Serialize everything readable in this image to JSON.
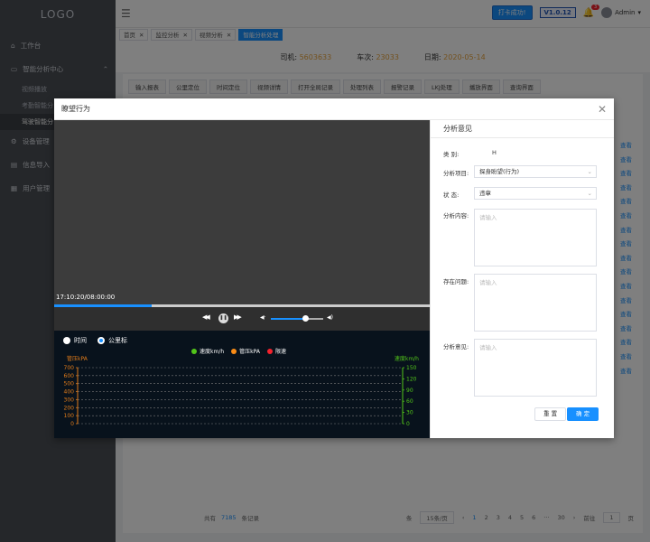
{
  "sidebar": {
    "logo": "LOGO",
    "items": [
      {
        "label": "工作台",
        "icon": "home-icon"
      },
      {
        "label": "智能分析中心",
        "icon": "monitor-icon",
        "expanded": true,
        "arrow": "⌃"
      },
      {
        "label": "视频播放",
        "sub": true
      },
      {
        "label": "考勤智能分",
        "sub": true
      },
      {
        "label": "驾驶智能分",
        "sub": true,
        "active": true
      },
      {
        "label": "设备管理",
        "icon": "gear-icon"
      },
      {
        "label": "信息导入",
        "icon": "import-icon"
      },
      {
        "label": "用户管理",
        "icon": "user-icon"
      }
    ]
  },
  "topbar": {
    "success_btn": "打卡成功!",
    "version": "V1.0.12",
    "badge": "3",
    "user": "Admin",
    "user_arrow": "▾"
  },
  "tabs": [
    {
      "label": "首页",
      "close": "✕"
    },
    {
      "label": "监控分析",
      "close": "✕"
    },
    {
      "label": "视频分析",
      "close": "✕"
    },
    {
      "label": "智能分析处理",
      "active": true
    }
  ],
  "info": {
    "driver_label": "司机:",
    "driver": "5603633",
    "train_label": "车次:",
    "train": "23033",
    "date_label": "日期:",
    "date": "2020-05-14"
  },
  "subtabs": [
    "输入报表",
    "公里定位",
    "时间定位",
    "视频详情",
    "打开全局记录",
    "处理列表",
    "报警记录",
    "LKJ处理",
    "播放界面",
    "查询界面"
  ],
  "side_links": [
    "查看",
    "查看",
    "查看",
    "查看",
    "查看",
    "查看",
    "查看",
    "查看",
    "查看",
    "查看",
    "查看",
    "查看",
    "查看",
    "查看",
    "查看",
    "查看",
    "查看"
  ],
  "pagination": {
    "total_pre": "共有",
    "total": "7185",
    "total_post": "条记录",
    "per_label": "条",
    "per": "15条/页",
    "pages": [
      "‹",
      "1",
      "2",
      "3",
      "4",
      "5",
      "6",
      "···",
      "30",
      "›"
    ],
    "goto": "前往",
    "goto_val": "1",
    "goto_unit": "页"
  },
  "modal": {
    "title": "瞭望行为",
    "close": "✕",
    "video_time": "17:10:20/08:00:00",
    "progress": 0.26,
    "volume": 0.65,
    "controls": {
      "rewind": "◀◀",
      "pause": "❚❚",
      "forward": "▶▶",
      "vol_down": "◀·",
      "vol_up": "◀)"
    },
    "radio": [
      {
        "label": "时间",
        "checked": false
      },
      {
        "label": "公里标",
        "checked": true
      }
    ],
    "legend": [
      {
        "label": "速度km/h",
        "color": "#52c41a"
      },
      {
        "label": "管压kPA",
        "color": "#fa8c16"
      },
      {
        "label": "限速",
        "color": "#f5222d"
      }
    ],
    "panel": {
      "title": "分析意见",
      "type_label": "类 别:",
      "type_val": "H",
      "item_label": "分析项目:",
      "item_val": "探身盼望(行为)",
      "state_label": "状 态:",
      "state_val": "违章",
      "content_label": "分析内容:",
      "problem_label": "存在问题:",
      "opinion_label": "分析意见:",
      "placeholder": "请输入",
      "chev": "⌄",
      "reset": "重 置",
      "confirm": "确 定"
    }
  },
  "chart_data": {
    "type": "line",
    "ylabel": "管压kPA",
    "y2label": "速度km/h",
    "ylim": [
      0,
      700
    ],
    "y2lim": [
      0,
      150
    ],
    "yticks": [
      700,
      600,
      500,
      400,
      300,
      200,
      100,
      0
    ],
    "y2ticks": [
      150,
      120,
      90,
      60,
      30,
      0
    ],
    "series": [],
    "grid": true
  }
}
